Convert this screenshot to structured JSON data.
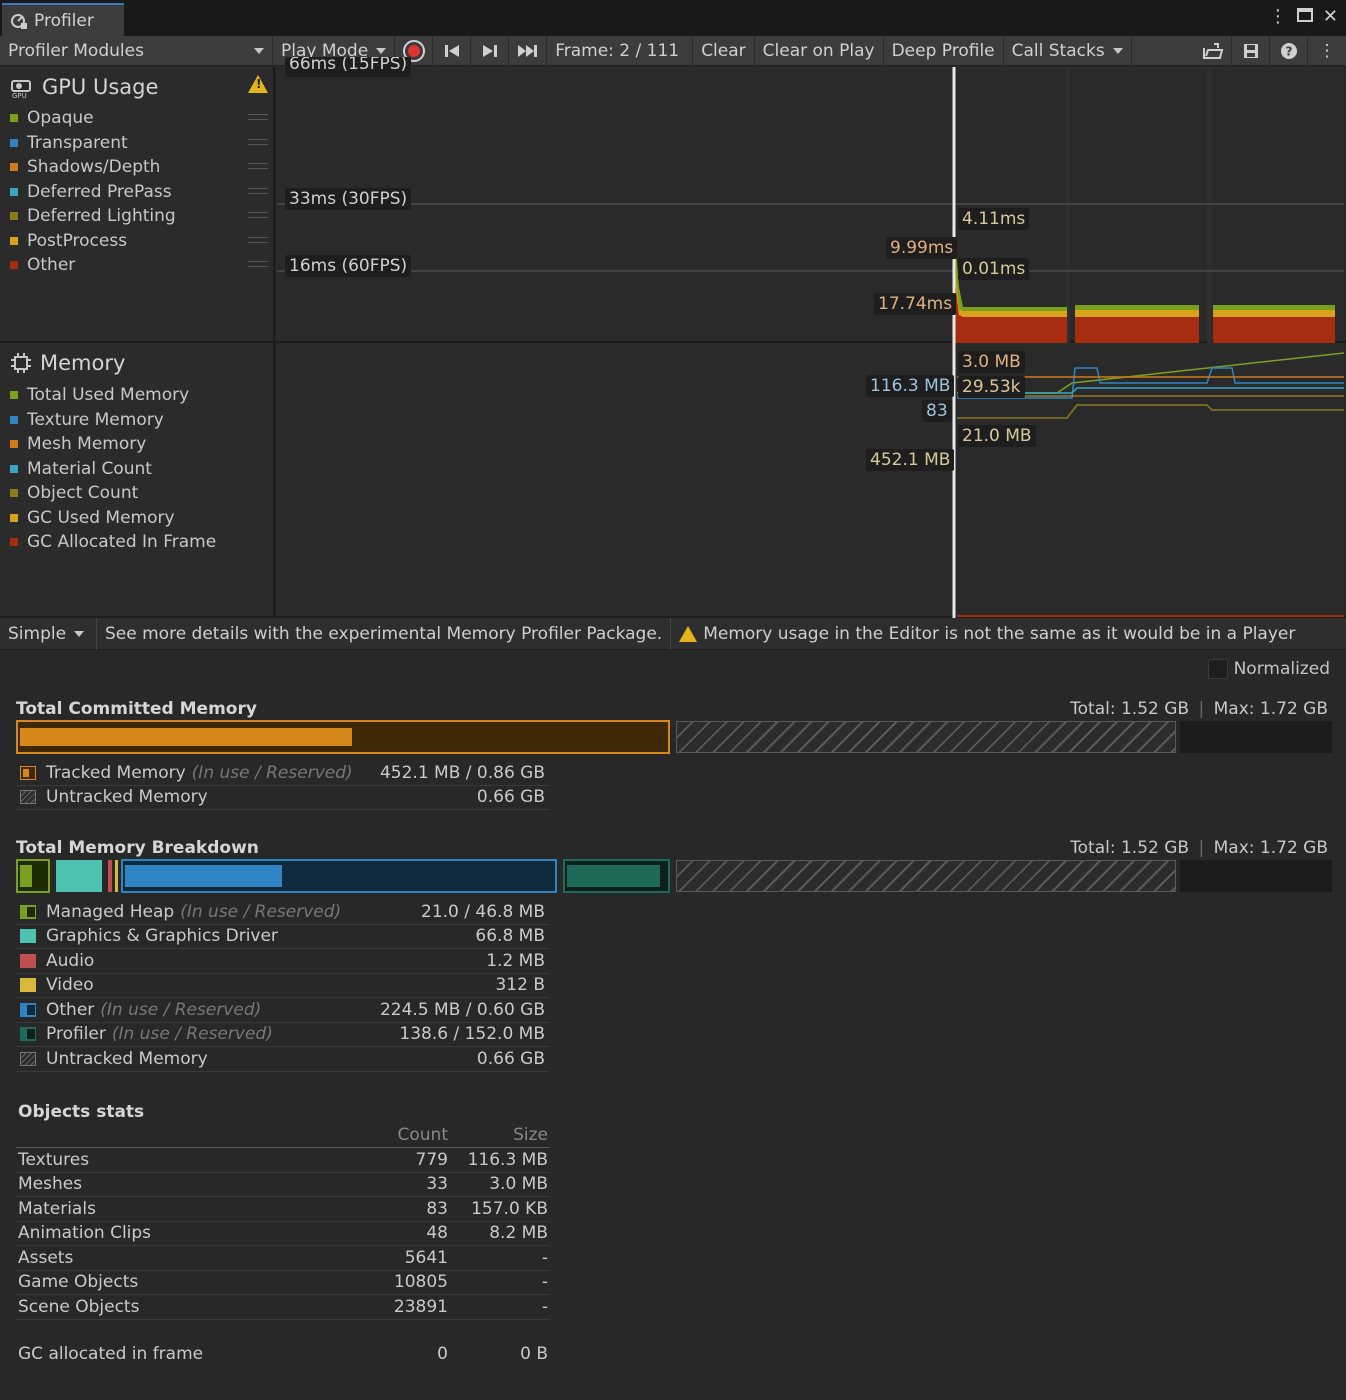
{
  "window": {
    "tab_title": "Profiler"
  },
  "toolbar": {
    "modules_label": "Profiler Modules",
    "play_mode_label": "Play Mode",
    "frame_label": "Frame: 2 / 111",
    "clear_label": "Clear",
    "clear_on_play_label": "Clear on Play",
    "deep_profile_label": "Deep Profile",
    "call_stacks_label": "Call Stacks"
  },
  "gpu_module": {
    "title": "GPU Usage",
    "legend": [
      {
        "label": "Opaque",
        "color": "#7aa11e"
      },
      {
        "label": "Transparent",
        "color": "#2f84c4"
      },
      {
        "label": "Shadows/Depth",
        "color": "#d07a1a"
      },
      {
        "label": "Deferred PrePass",
        "color": "#38a6c4"
      },
      {
        "label": "Deferred Lighting",
        "color": "#8a7a1c"
      },
      {
        "label": "PostProcess",
        "color": "#d8a21c"
      },
      {
        "label": "Other",
        "color": "#a82c10"
      }
    ],
    "top_cut_label": "66ms (15FPS)",
    "line_33": "33ms (30FPS)",
    "line_16": "16ms (60FPS)",
    "cursor_labels": {
      "a": "4.11ms",
      "b": "9.99ms",
      "c": "0.01ms",
      "d": "17.74ms"
    }
  },
  "memory_module": {
    "title": "Memory",
    "legend": [
      {
        "label": "Total Used Memory",
        "color": "#7aa11e"
      },
      {
        "label": "Texture Memory",
        "color": "#2f84c4"
      },
      {
        "label": "Mesh Memory",
        "color": "#d07a1a"
      },
      {
        "label": "Material Count",
        "color": "#38a6c4"
      },
      {
        "label": "Object Count",
        "color": "#8a7a1c"
      },
      {
        "label": "GC Used Memory",
        "color": "#d8a21c"
      },
      {
        "label": "GC Allocated In Frame",
        "color": "#a82c10"
      }
    ],
    "cursor_labels": {
      "a": "3.0 MB",
      "b": "116.3 MB",
      "c": "29.53k",
      "d": "83",
      "e": "21.0 MB",
      "f": "452.1 MB"
    }
  },
  "subbar": {
    "mode_label": "Simple",
    "details_link": "See more details with the experimental Memory Profiler Package.",
    "warning": "Memory usage in the Editor is not the same as it would be in a Player"
  },
  "details": {
    "normalized_label": "Normalized",
    "committed": {
      "title": "Total Committed Memory",
      "total": "Total: 1.52 GB",
      "max": "Max: 1.72 GB",
      "rows": [
        {
          "name": "Tracked Memory",
          "note": "(In use / Reserved)",
          "value": "452.1 MB / 0.86 GB",
          "color": "#d6871a"
        },
        {
          "name": "Untracked Memory",
          "note": "",
          "value": "0.66 GB",
          "color": "#3a3a3a"
        }
      ]
    },
    "breakdown": {
      "title": "Total Memory Breakdown",
      "total": "Total: 1.52 GB",
      "max": "Max: 1.72 GB",
      "rows": [
        {
          "name": "Managed Heap",
          "note": "(In use / Reserved)",
          "value": "21.0 / 46.8 MB",
          "color": "#7aa11e"
        },
        {
          "name": "Graphics & Graphics Driver",
          "note": "",
          "value": "66.8 MB",
          "color": "#4ec2b0"
        },
        {
          "name": "Audio",
          "note": "",
          "value": "1.2 MB",
          "color": "#c05050"
        },
        {
          "name": "Video",
          "note": "",
          "value": "312 B",
          "color": "#d8b83a"
        },
        {
          "name": "Other",
          "note": "(In use / Reserved)",
          "value": "224.5 MB / 0.60 GB",
          "color": "#2f84c4"
        },
        {
          "name": "Profiler",
          "note": "(In use / Reserved)",
          "value": "138.6 / 152.0 MB",
          "color": "#1e6a5a"
        },
        {
          "name": "Untracked Memory",
          "note": "",
          "value": "0.66 GB",
          "color": "#3a3a3a"
        }
      ]
    },
    "objects": {
      "title": "Objects stats",
      "col_count": "Count",
      "col_size": "Size",
      "rows": [
        {
          "name": "Textures",
          "count": "779",
          "size": "116.3 MB"
        },
        {
          "name": "Meshes",
          "count": "33",
          "size": "3.0 MB"
        },
        {
          "name": "Materials",
          "count": "83",
          "size": "157.0 KB"
        },
        {
          "name": "Animation Clips",
          "count": "48",
          "size": "8.2 MB"
        },
        {
          "name": "Assets",
          "count": "5641",
          "size": "-"
        },
        {
          "name": "Game Objects",
          "count": "10805",
          "size": "-"
        },
        {
          "name": "Scene Objects",
          "count": "23891",
          "size": "-"
        }
      ],
      "gc": {
        "name": "GC allocated in frame",
        "count": "0",
        "size": "0 B"
      }
    }
  }
}
